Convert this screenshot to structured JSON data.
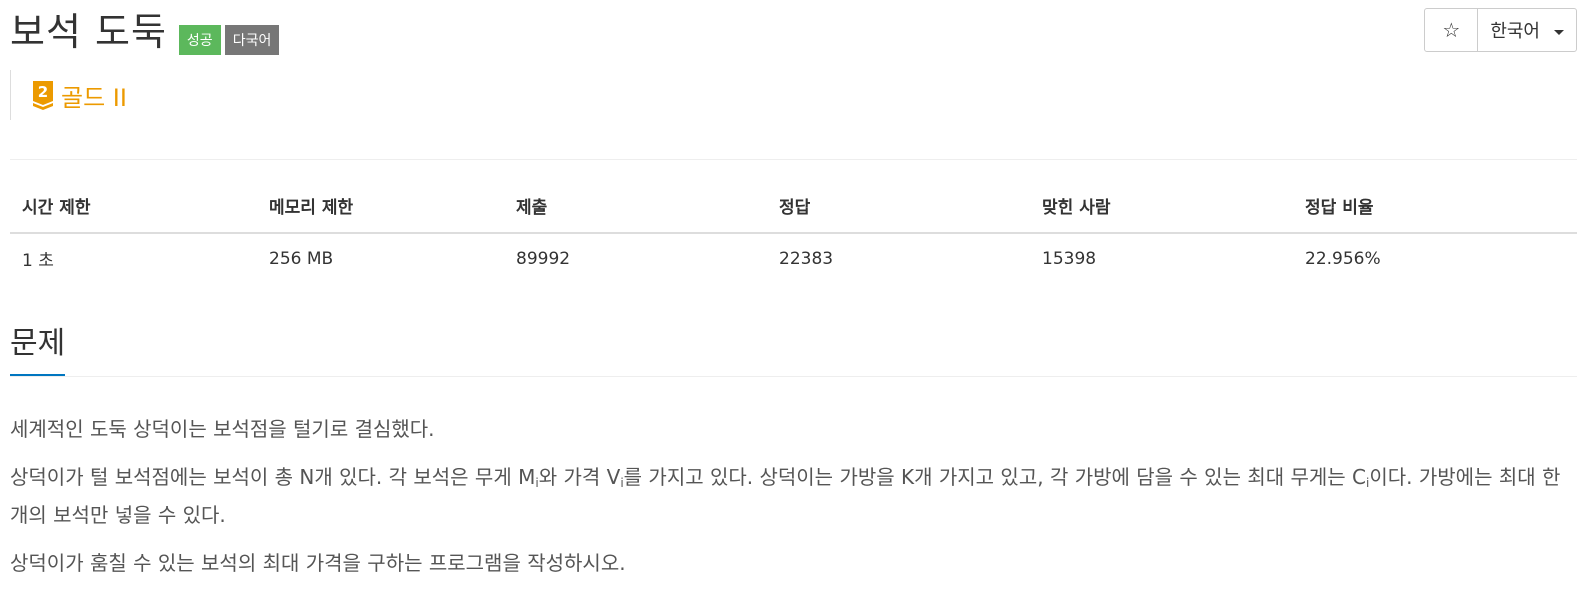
{
  "problem": {
    "title": "보석 도둑",
    "badges": {
      "status": "성공",
      "multilang": "다국어"
    }
  },
  "toolbar": {
    "star_icon": "star-outline",
    "language": "한국어"
  },
  "tier": {
    "level_number": "2",
    "label": "골드 II",
    "color": "#ec9a00"
  },
  "stats": {
    "headers": [
      "시간 제한",
      "메모리 제한",
      "제출",
      "정답",
      "맞힌 사람",
      "정답 비율"
    ],
    "values": [
      "1 초",
      "256 MB",
      "89992",
      "22383",
      "15398",
      "22.956%"
    ]
  },
  "section": {
    "title": "문제"
  },
  "description": {
    "p1": "세계적인 도둑 상덕이는 보석점을 털기로 결심했다.",
    "p2_a": "상덕이가 털 보석점에는 보석이 총 N개 있다. 각 보석은 무게 M",
    "p2_sub1": "i",
    "p2_b": "와 가격 V",
    "p2_sub2": "i",
    "p2_c": "를 가지고 있다. 상덕이는 가방을 K개 가지고 있고, 각 가방에 담을 수 있는 최대 무게는 C",
    "p2_sub3": "i",
    "p2_d": "이다. 가방에는 최대 한 개의 보석만 넣을 수 있다.",
    "p3": "상덕이가 훔칠 수 있는 보석의 최대 가격을 구하는 프로그램을 작성하시오."
  }
}
